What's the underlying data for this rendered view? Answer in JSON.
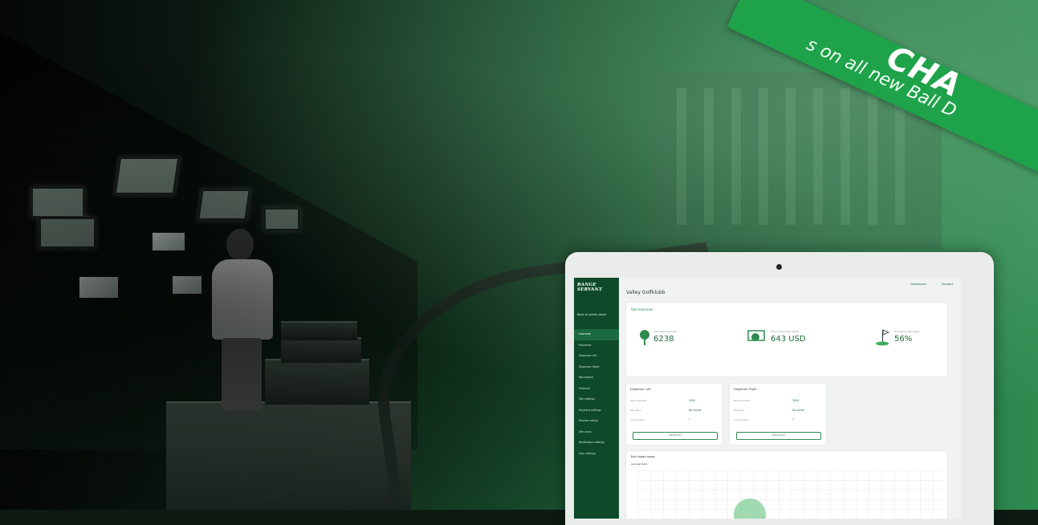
{
  "banner": {
    "headline": "CHA",
    "subline": "s on all new Ball D"
  },
  "laptop": {
    "brand": "RANGE SERVANT",
    "back_link": "Back to admin panel",
    "topbar": {
      "dashboard": "Dashboard",
      "support": "Support"
    },
    "club_name": "Valley Golfklubb",
    "overview": {
      "title": "Site overview",
      "stats": [
        {
          "label": "Total dispensed balls",
          "value": "6238",
          "icon": "tee-ball-icon"
        },
        {
          "label": "Total revenue this month",
          "value": "643 USD",
          "icon": "cash-register-icon"
        },
        {
          "label": "Occupancy rate today",
          "value": "56%",
          "icon": "golf-flag-icon"
        }
      ]
    },
    "dispensers": [
      {
        "title": "Dispenser Left",
        "rows": [
          {
            "label": "Balls dispensed",
            "value": "2094"
          },
          {
            "label": "Ball status",
            "value": "No issues"
          },
          {
            "label": "Current status",
            "value": "*"
          }
        ],
        "button": "SEE DETAILS"
      },
      {
        "title": "Dispenser Right",
        "rows": [
          {
            "label": "Balls dispensed",
            "value": "2094"
          },
          {
            "label": "Ball status",
            "value": "No issues"
          },
          {
            "label": "Current status",
            "value": "*"
          }
        ],
        "button": "SEE DETAILS"
      }
    ],
    "usage": {
      "title": "Ball usage today",
      "subtitle": "Average balls"
    },
    "nav": [
      {
        "label": "Overview",
        "active": true
      },
      {
        "label": "Payments"
      },
      {
        "label": "Dispenser left"
      },
      {
        "label": "Dispenser Right"
      },
      {
        "label": "Ball washer"
      },
      {
        "label": "Products"
      },
      {
        "label": "Site settings"
      },
      {
        "label": "Payment settings"
      },
      {
        "label": "Machine status"
      },
      {
        "label": "Site users"
      },
      {
        "label": "Notification settings"
      },
      {
        "label": "User settings"
      }
    ]
  }
}
